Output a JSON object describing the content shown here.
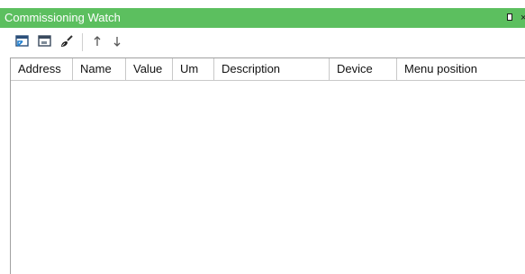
{
  "panel": {
    "title": "Commissioning Watch",
    "title_bar_color": "#5cbf5f",
    "pin_icon": "pin-icon",
    "close_icon": "close-icon"
  },
  "toolbar": {
    "buttons": [
      {
        "name": "add-variable-button",
        "icon": "window-add-icon"
      },
      {
        "name": "remove-variable-button",
        "icon": "window-remove-icon"
      },
      {
        "name": "clear-button",
        "icon": "brush-icon"
      },
      {
        "name": "move-up-button",
        "icon": "arrow-up-icon"
      },
      {
        "name": "move-down-button",
        "icon": "arrow-down-icon"
      }
    ]
  },
  "table": {
    "columns": [
      "Address",
      "Name",
      "Value",
      "Um",
      "Description",
      "Device",
      "Menu position"
    ],
    "rows": []
  }
}
